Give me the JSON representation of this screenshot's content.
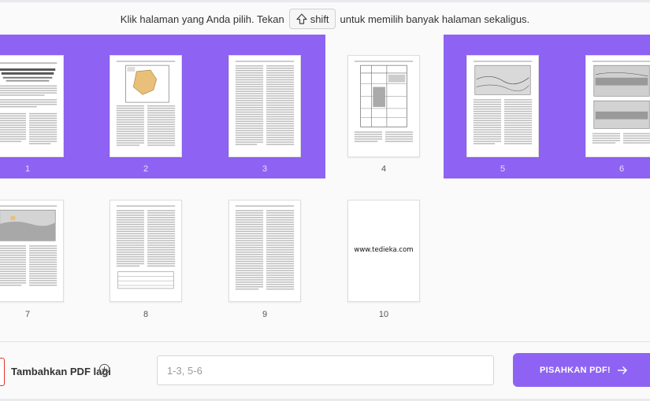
{
  "instruction": {
    "before": "Klik halaman yang Anda pilih. Tekan",
    "key_label": "shift",
    "after": "untuk memilih banyak halaman sekaligus."
  },
  "pages": [
    {
      "num": "1",
      "selected": true
    },
    {
      "num": "2",
      "selected": true
    },
    {
      "num": "3",
      "selected": true
    },
    {
      "num": "4",
      "selected": false
    },
    {
      "num": "5",
      "selected": true
    },
    {
      "num": "6",
      "selected": true
    },
    {
      "num": "7",
      "selected": false
    },
    {
      "num": "8",
      "selected": false
    },
    {
      "num": "9",
      "selected": false
    },
    {
      "num": "10",
      "selected": false,
      "watermark": "www.tedieka.com"
    }
  ],
  "bottom": {
    "add_label": "Tambahkan PDF lagi",
    "range_placeholder": "1-3, 5-6",
    "split_label": "PISAHKAN PDF!"
  },
  "colors": {
    "accent": "#8e63f4",
    "add_icon_border": "#e5322d"
  }
}
